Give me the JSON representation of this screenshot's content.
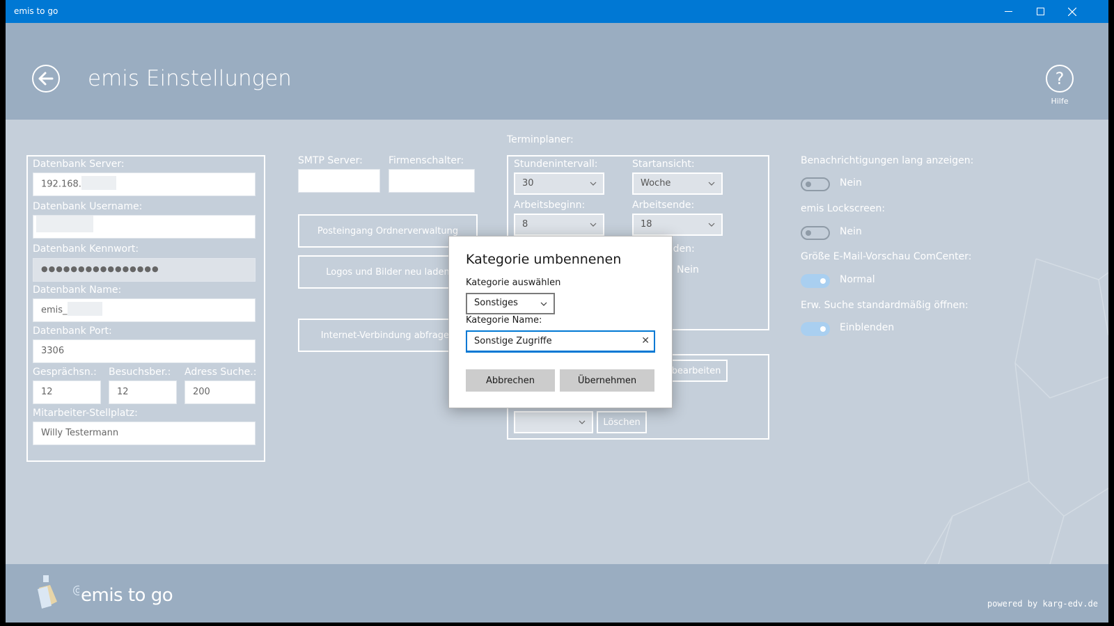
{
  "window": {
    "title": "emis to go"
  },
  "header": {
    "title": "emis Einstellungen",
    "help_label": "Hilfe"
  },
  "db_panel": {
    "server_label": "Datenbank Server:",
    "server_value": "192.168.",
    "username_label": "Datenbank Username:",
    "password_label": "Datenbank Kennwort:",
    "password_value": "●●●●●●●●●●●●●●●●",
    "name_label": "Datenbank Name:",
    "name_value": "emis_",
    "port_label": "Datenbank Port:",
    "port_value": "3306",
    "gespraech_label": "Gesprächsn.:",
    "gespraech_value": "12",
    "besuch_label": "Besuchsber.:",
    "besuch_value": "12",
    "adress_label": "Adress Suche.:",
    "adress_value": "200",
    "mitarbeiter_label": "Mitarbeiter-Stellplatz:",
    "mitarbeiter_value": "Willy Testermann"
  },
  "mail_panel": {
    "smtp_label": "SMTP Server:",
    "smtp_value": "",
    "firmen_label": "Firmenschalter:",
    "firmen_value": "",
    "posteingang_button": "Posteingang Ordnerverwaltung",
    "logos_button": "Logos und Bilder neu laden",
    "internet_button": "Internet-Verbindung abfragen"
  },
  "terminplaner": {
    "heading": "Terminplaner:",
    "stundenintervall_label": "Stundenintervall:",
    "stundenintervall_value": "30",
    "startansicht_label": "Startansicht:",
    "startansicht_value": "Woche",
    "arbeitsbeginn_label": "Arbeitsbeginn:",
    "arbeitsbeginn_value": "8",
    "arbeitsende_label": "Arbeitsende:",
    "arbeitsende_value": "18",
    "partial_label": "aden:",
    "partial_toggle_value": "Nein"
  },
  "kategorie_panel": {
    "bearbeiten_button": "bearbeiten",
    "select_value": "",
    "loeschen_button": "Löschen"
  },
  "settings": {
    "benachrichtigungen_label": "Benachrichtigungen lang anzeigen:",
    "benachrichtigungen_value": "Nein",
    "lockscreen_label": "emis Lockscreen:",
    "lockscreen_value": "Nein",
    "vorschau_label": "Größe E-Mail-Vorschau ComCenter:",
    "vorschau_value": "Normal",
    "suche_label": "Erw. Suche standardmäßig öffnen:",
    "suche_value": "Einblenden"
  },
  "dialog": {
    "title": "Kategorie umbennenen",
    "select_label": "Kategorie auswählen",
    "select_value": "Sonstiges",
    "name_label": "Kategorie Name:",
    "name_value": "Sonstige Zugriffe",
    "cancel_button": "Abbrechen",
    "apply_button": "Übernehmen"
  },
  "footer": {
    "logo_text": "emis to go",
    "powered": "powered by karg-edv.de"
  },
  "colors": {
    "titlebar": "#0078d4",
    "background": "#c5cfda",
    "header": "#9aadc1",
    "toggle_on": "#a9cff0"
  },
  "icons": {
    "back": "back-arrow-icon",
    "help": "help-icon",
    "minimize": "minimize-icon",
    "maximize": "maximize-icon",
    "close": "close-icon",
    "chevron": "chevron-down-icon",
    "clear": "clear-icon"
  }
}
